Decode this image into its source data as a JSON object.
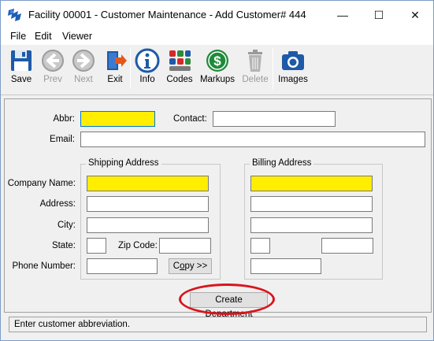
{
  "window": {
    "title": "Facility 00001 - Customer Maintenance - Add Customer# 444",
    "min_glyph": "—",
    "max_glyph": "☐",
    "close_glyph": "✕"
  },
  "menu": {
    "file": "File",
    "edit": "Edit",
    "viewer": "Viewer"
  },
  "toolbar": {
    "save": "Save",
    "prev": "Prev",
    "next": "Next",
    "exit": "Exit",
    "info": "Info",
    "codes": "Codes",
    "markups": "Markups",
    "delete": "Delete",
    "images": "Images"
  },
  "form": {
    "abbr_label": "Abbr:",
    "contact_label": "Contact:",
    "email_label": "Email:",
    "shipping_title": "Shipping Address",
    "billing_title": "Billing Address",
    "company_label": "Company Name:",
    "address_label": "Address:",
    "city_label": "City:",
    "state_label": "State:",
    "zip_label": "Zip Code:",
    "phone_label": "Phone Number:",
    "copy_prefix": "C",
    "copy_underlined": "o",
    "copy_suffix": "py >>",
    "create_prefix": "Create ",
    "create_underlined": "D",
    "create_suffix": "epartment"
  },
  "status_text": "Enter customer abbreviation.",
  "colors": {
    "required_field": "#ffee00",
    "highlight_ring": "#d9151c",
    "focus_border": "#0078d7"
  }
}
